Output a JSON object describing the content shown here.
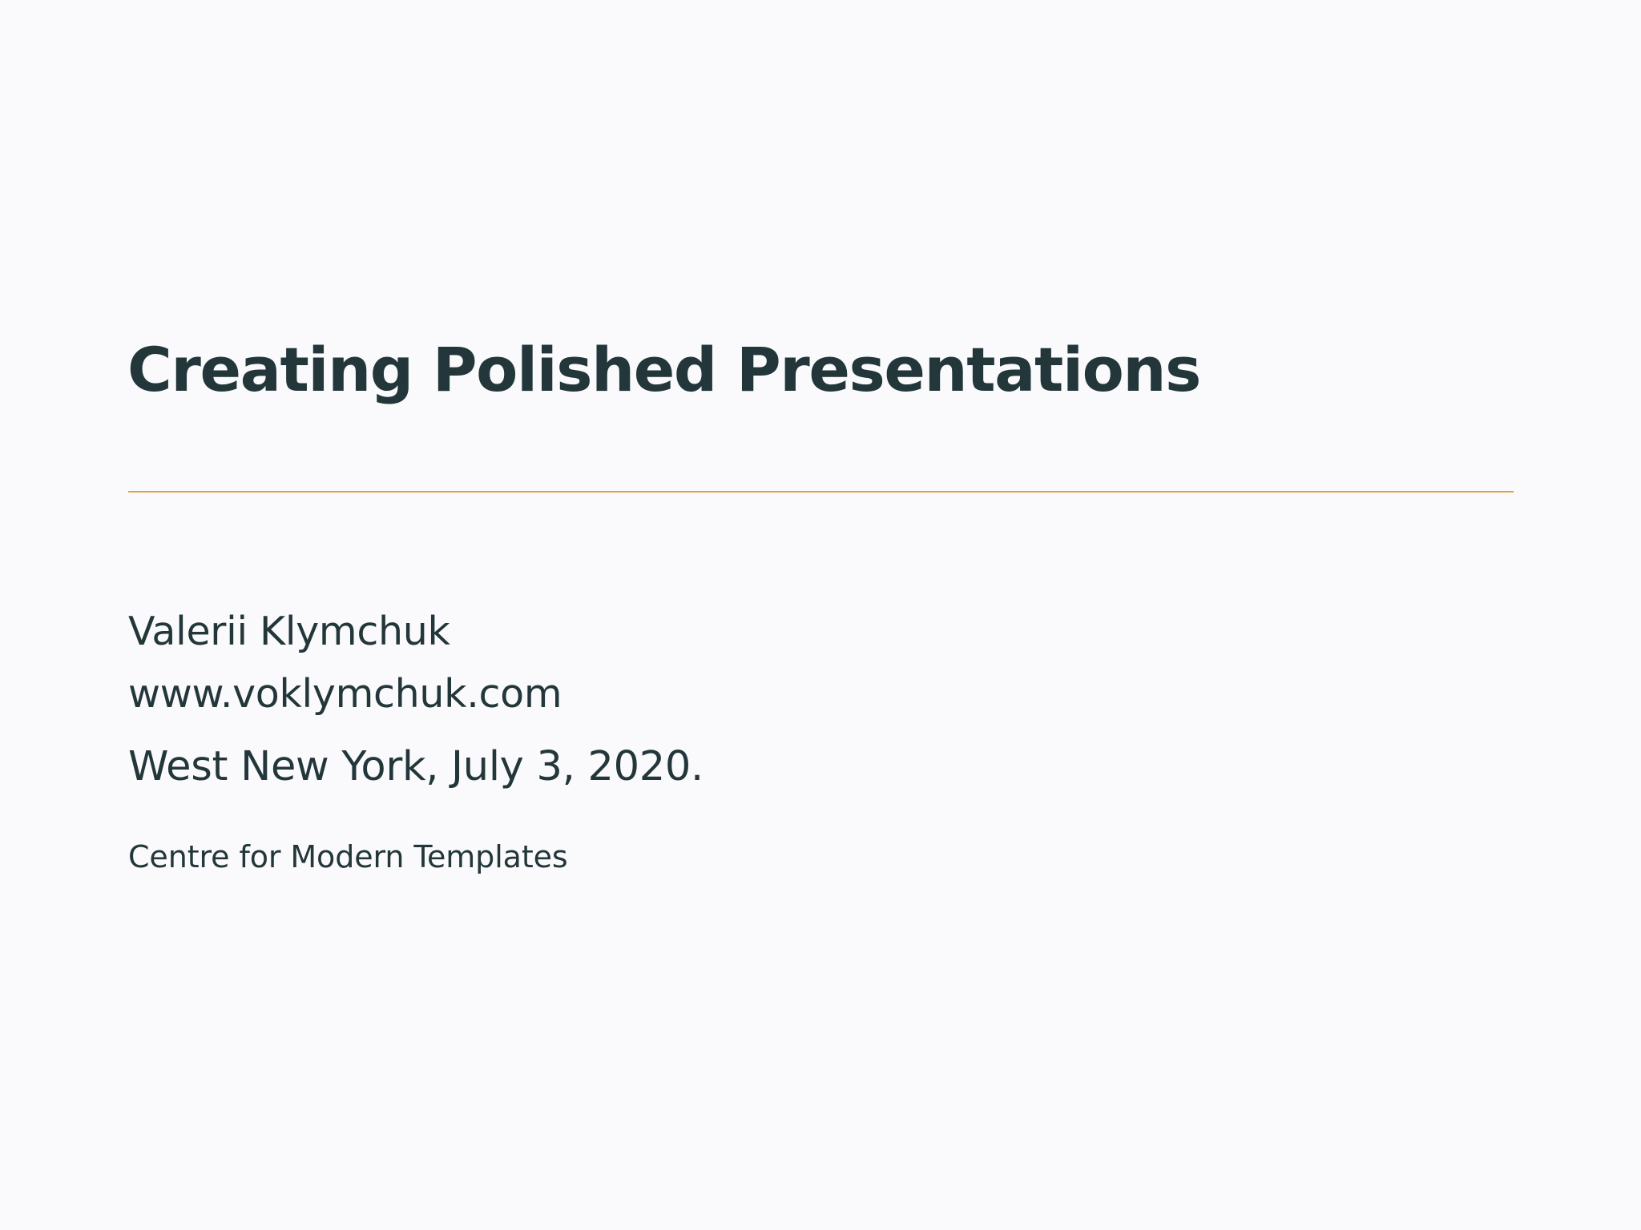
{
  "slide": {
    "title": "Creating Polished Presentations",
    "author": "Valerii Klymchuk",
    "website": "www.voklymchuk.com",
    "date": "West New York, July 3, 2020.",
    "institute": "Centre for Modern Templates"
  },
  "colors": {
    "background": "#FAFAFC",
    "text": "#23373B",
    "accent_rule": "#E0A03A"
  }
}
